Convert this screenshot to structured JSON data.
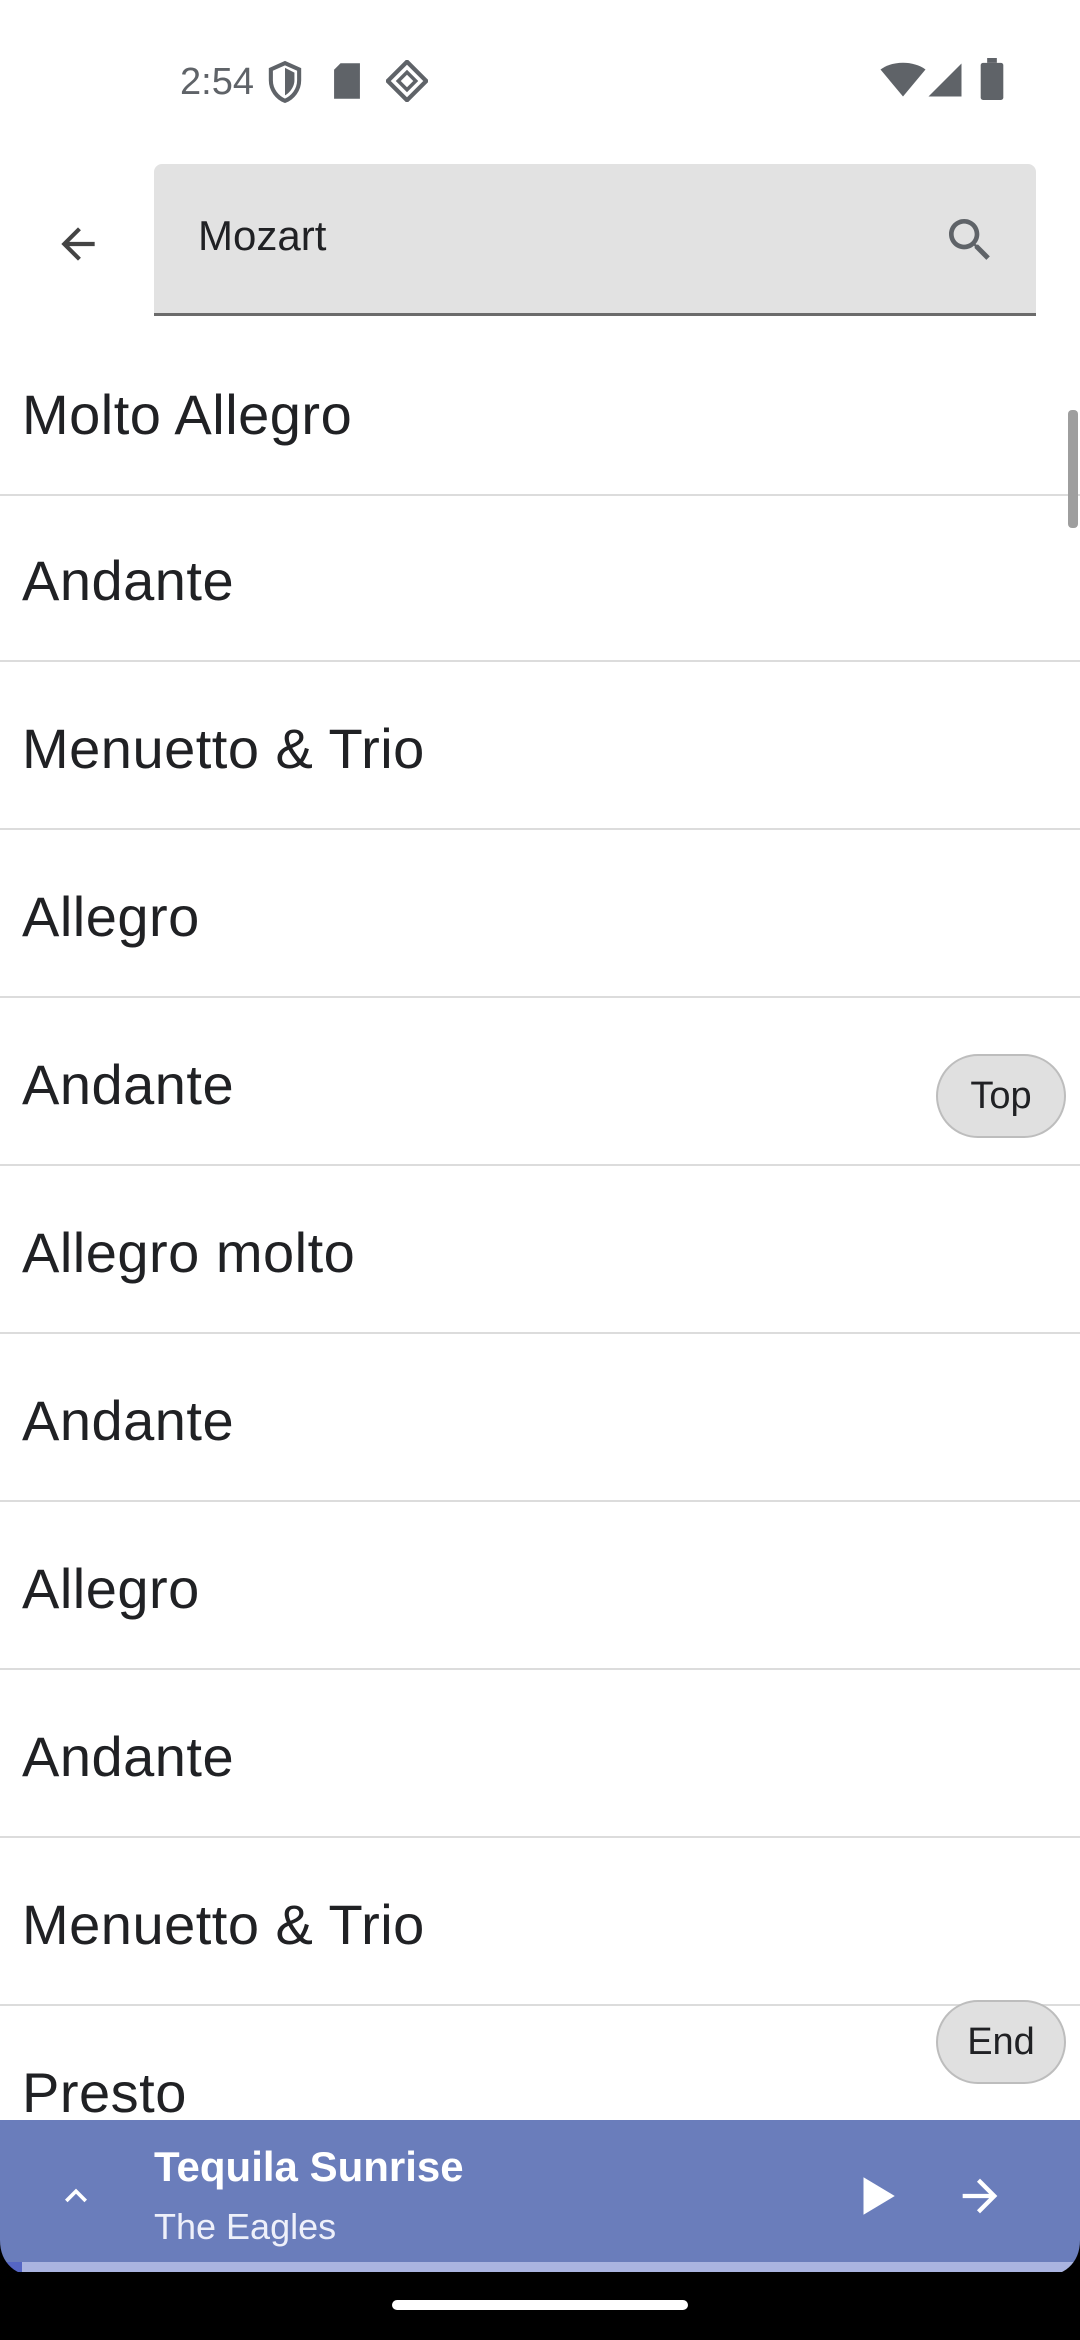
{
  "status_bar": {
    "time": "2:54",
    "left_icons": [
      "shield-icon",
      "sd-card-icon",
      "diamond-icon"
    ],
    "right_icons": [
      "wifi-icon",
      "signal-icon",
      "battery-icon"
    ]
  },
  "search": {
    "value": "Mozart",
    "placeholder": "Search"
  },
  "results": [
    "Molto Allegro",
    "Andante",
    "Menuetto & Trio",
    "Allegro",
    "Andante",
    "Allegro molto",
    "Andante",
    "Allegro",
    "Andante",
    "Menuetto & Trio",
    "Presto"
  ],
  "fast_scroll": {
    "top_label": "Top",
    "end_label": "End"
  },
  "player": {
    "title": "Tequila Sunrise",
    "artist": "The Eagles",
    "progress_fraction": 0.02
  },
  "colors": {
    "player_bg": "#6a7dbb",
    "progress_fill": "#5566c4",
    "progress_track": "#aab4e0",
    "search_bg": "#e2e2e2"
  }
}
